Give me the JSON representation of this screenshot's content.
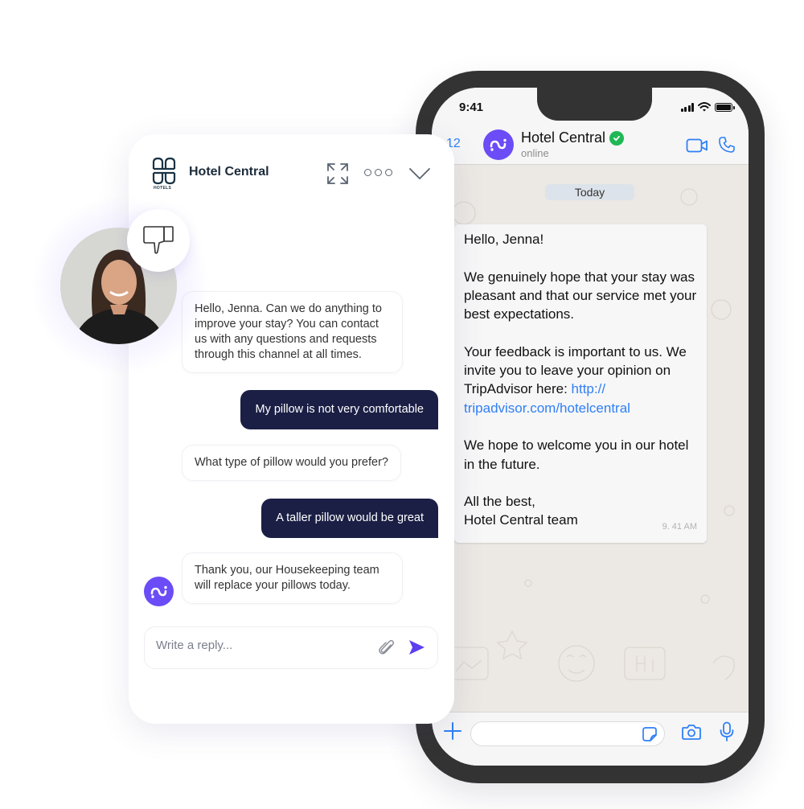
{
  "phone": {
    "status_time": "9:41",
    "header": {
      "back_count": "12",
      "contact_name": "Hotel Central",
      "contact_status": "online",
      "verified": true
    },
    "date_separator": "Today",
    "message": {
      "paragraphs": [
        "Hello, Jenna!",
        "We genuinely hope that your stay was pleasant and that our service met your best expectations."
      ],
      "feedback_text": "Your feedback is important to us. We invite you to leave your opinion on TripAdvisor here: ",
      "link": "http:// tripadvisor.com/hotelcentral",
      "closing": "We hope to welcome you in our hotel in the future.",
      "signoff_line1": "All the best,",
      "signoff_line2": "Hotel Central team",
      "time": "9. 41 AM"
    },
    "icons": [
      "back-icon",
      "video-call-icon",
      "phone-call-icon",
      "plus-icon",
      "sticker-icon",
      "camera-icon",
      "microphone-icon",
      "signal-icon",
      "wifi-icon",
      "battery-icon",
      "verified-badge-icon"
    ],
    "colors": {
      "accent": "#2f7ff6",
      "verified": "#1fb855",
      "avatar": "#6b4cf6"
    }
  },
  "widget": {
    "logo_text": "HOTELS",
    "title": "Hotel Central",
    "icons": [
      "expand-icon",
      "more-icon",
      "collapse-icon",
      "thumbs-down-icon",
      "attach-icon",
      "send-icon"
    ],
    "messages": [
      {
        "from": "bot",
        "text": "Hello, Jenna. Can we do anything to improve your stay? You can contact us with any questions and requests through this channel at all times."
      },
      {
        "from": "user",
        "text": "My pillow is not very comfortable"
      },
      {
        "from": "bot",
        "text": "What type of pillow would you prefer?"
      },
      {
        "from": "user",
        "text": "A taller pillow would be great"
      },
      {
        "from": "bot",
        "text": "Thank you, our Housekeeping team will replace your pillows today."
      }
    ],
    "reply_placeholder": "Write a reply...",
    "colors": {
      "user_bubble": "#1b1f45",
      "accent": "#6b4cf6"
    }
  }
}
